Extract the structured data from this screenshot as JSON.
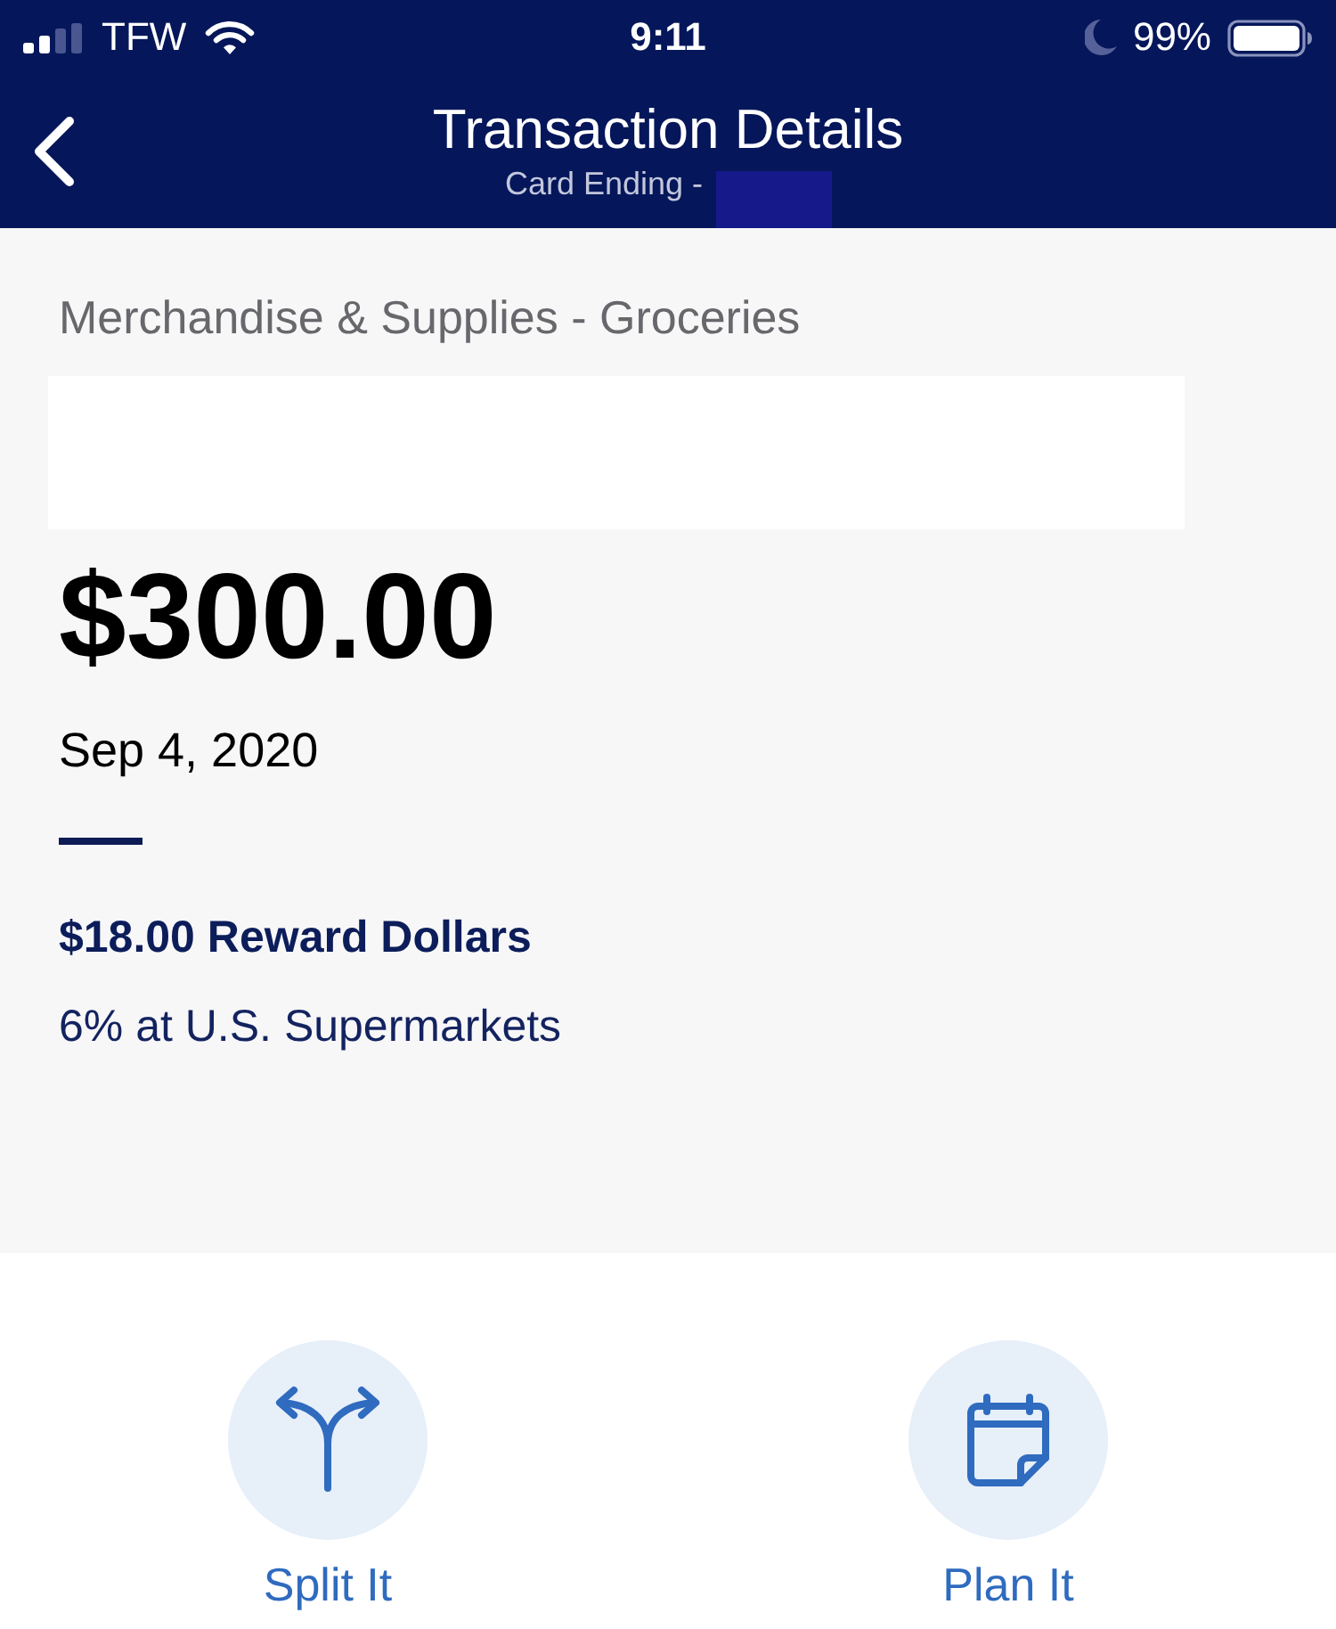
{
  "status_bar": {
    "carrier": "TFW",
    "time": "9:11",
    "battery": "99%"
  },
  "header": {
    "title": "Transaction Details",
    "subtitle": "Card Ending -"
  },
  "transaction": {
    "category": "Merchandise & Supplies - Groceries",
    "amount": "$300.00",
    "date": "Sep 4, 2020",
    "reward": "$18.00 Reward Dollars",
    "reward_rate": "6% at U.S. Supermarkets"
  },
  "actions": [
    {
      "kind": "split",
      "label": "Split It"
    },
    {
      "kind": "plan",
      "label": "Plan It"
    }
  ]
}
